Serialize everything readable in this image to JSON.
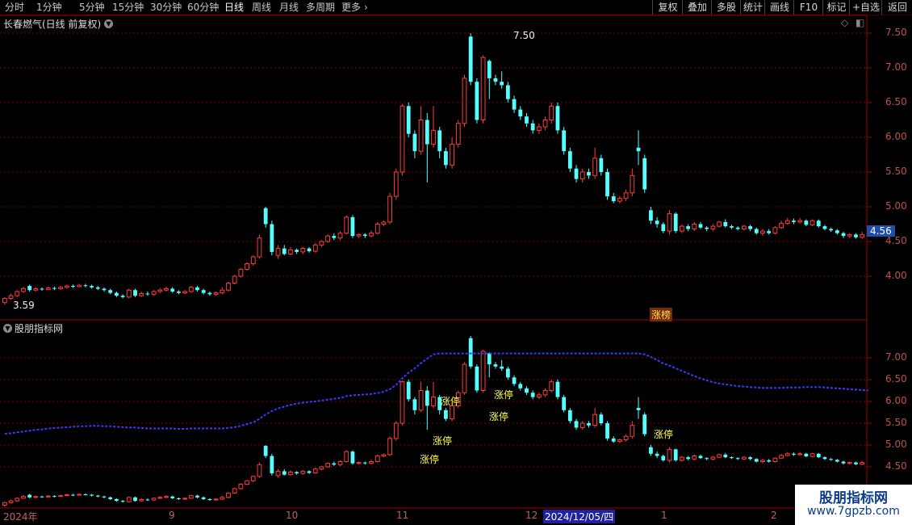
{
  "toolbar": {
    "periods": [
      "分时",
      "1分钟",
      "5分钟",
      "15分钟",
      "30分钟",
      "60分钟",
      "日线",
      "周线",
      "月线",
      "多周期",
      "更多"
    ],
    "active_period": "日线",
    "right_buttons": [
      "复权",
      "叠加",
      "多股",
      "统计",
      "画线",
      "F10",
      "标记",
      "+自选",
      "返回"
    ]
  },
  "main_panel": {
    "title": "长春燃气(日线 前复权)",
    "high_label": "7.50",
    "low_label": "3.59",
    "current_price": "4.56",
    "badge": "涨榜",
    "y_ticks": [
      "7.50",
      "7.00",
      "6.50",
      "6.00",
      "5.50",
      "5.00",
      "4.50",
      "4.00"
    ]
  },
  "indicator_panel": {
    "title": "股朋指标网",
    "y_ticks": [
      "7.00",
      "6.50",
      "6.00",
      "5.50",
      "5.00",
      "4.50"
    ],
    "signal_label": "涨停"
  },
  "x_axis": {
    "labels": [
      "2024年",
      "9",
      "10",
      "11",
      "12",
      "1",
      "2"
    ],
    "cursor_date": "2024/12/05/四"
  },
  "watermark": {
    "title": "股朋指标网",
    "url": "www.7gpzb.com"
  },
  "colors": {
    "up": "#ff3b3b",
    "down": "#54ffff",
    "grid": "#7a0000",
    "ma": "#3b3bff",
    "signal": "#ffff44"
  },
  "chart_data": {
    "type": "candlestick",
    "title": "长春燃气(日线 前复权)",
    "ylim": [
      3.55,
      7.7
    ],
    "candles": [
      [
        3.62,
        3.68,
        3.59,
        3.7
      ],
      [
        3.68,
        3.72,
        3.66,
        3.75
      ],
      [
        3.72,
        3.78,
        3.7,
        3.8
      ],
      [
        3.78,
        3.82,
        3.76,
        3.85
      ],
      [
        3.86,
        3.8,
        3.78,
        3.88
      ],
      [
        3.8,
        3.82,
        3.78,
        3.84
      ],
      [
        3.82,
        3.81,
        3.79,
        3.84
      ],
      [
        3.81,
        3.83,
        3.8,
        3.85
      ],
      [
        3.83,
        3.82,
        3.8,
        3.85
      ],
      [
        3.82,
        3.84,
        3.81,
        3.86
      ],
      [
        3.84,
        3.86,
        3.82,
        3.88
      ],
      [
        3.86,
        3.85,
        3.83,
        3.88
      ],
      [
        3.85,
        3.87,
        3.84,
        3.89
      ],
      [
        3.87,
        3.86,
        3.84,
        3.89
      ],
      [
        3.86,
        3.84,
        3.82,
        3.88
      ],
      [
        3.84,
        3.82,
        3.8,
        3.86
      ],
      [
        3.82,
        3.8,
        3.78,
        3.84
      ],
      [
        3.8,
        3.76,
        3.74,
        3.82
      ],
      [
        3.76,
        3.72,
        3.7,
        3.78
      ],
      [
        3.72,
        3.7,
        3.68,
        3.74
      ],
      [
        3.7,
        3.8,
        3.68,
        3.82
      ],
      [
        3.8,
        3.72,
        3.7,
        3.82
      ],
      [
        3.72,
        3.75,
        3.7,
        3.78
      ],
      [
        3.75,
        3.74,
        3.72,
        3.78
      ],
      [
        3.74,
        3.78,
        3.72,
        3.8
      ],
      [
        3.78,
        3.8,
        3.76,
        3.83
      ],
      [
        3.8,
        3.82,
        3.78,
        3.85
      ],
      [
        3.82,
        3.78,
        3.76,
        3.84
      ],
      [
        3.78,
        3.76,
        3.74,
        3.8
      ],
      [
        3.76,
        3.78,
        3.74,
        3.8
      ],
      [
        3.78,
        3.84,
        3.76,
        3.86
      ],
      [
        3.84,
        3.8,
        3.78,
        3.86
      ],
      [
        3.8,
        3.76,
        3.74,
        3.82
      ],
      [
        3.76,
        3.74,
        3.72,
        3.78
      ],
      [
        3.74,
        3.76,
        3.72,
        3.78
      ],
      [
        3.76,
        3.8,
        3.74,
        3.84
      ],
      [
        3.8,
        3.9,
        3.78,
        3.92
      ],
      [
        3.9,
        4.0,
        3.88,
        4.02
      ],
      [
        4.0,
        4.1,
        3.98,
        4.12
      ],
      [
        4.1,
        4.18,
        4.08,
        4.2
      ],
      [
        4.18,
        4.28,
        4.15,
        4.3
      ],
      [
        4.28,
        4.55,
        4.25,
        4.6
      ],
      [
        4.98,
        4.75,
        4.7,
        5.0
      ],
      [
        4.75,
        4.35,
        4.3,
        4.8
      ],
      [
        4.3,
        4.4,
        4.25,
        4.45
      ],
      [
        4.4,
        4.32,
        4.3,
        4.45
      ],
      [
        4.32,
        4.38,
        4.3,
        4.42
      ],
      [
        4.38,
        4.35,
        4.32,
        4.4
      ],
      [
        4.35,
        4.4,
        4.32,
        4.42
      ],
      [
        4.4,
        4.36,
        4.34,
        4.42
      ],
      [
        4.36,
        4.45,
        4.34,
        4.48
      ],
      [
        4.45,
        4.5,
        4.42,
        4.52
      ],
      [
        4.5,
        4.58,
        4.48,
        4.6
      ],
      [
        4.58,
        4.55,
        4.52,
        4.62
      ],
      [
        4.55,
        4.62,
        4.52,
        4.65
      ],
      [
        4.62,
        4.85,
        4.6,
        4.88
      ],
      [
        4.85,
        4.58,
        4.55,
        4.88
      ],
      [
        4.58,
        4.6,
        4.55,
        4.62
      ],
      [
        4.6,
        4.58,
        4.55,
        4.62
      ],
      [
        4.58,
        4.62,
        4.56,
        4.66
      ],
      [
        4.62,
        4.75,
        4.6,
        4.78
      ],
      [
        4.75,
        4.78,
        4.72,
        4.8
      ],
      [
        4.78,
        5.15,
        4.75,
        5.2
      ],
      [
        5.15,
        5.5,
        5.1,
        5.55
      ],
      [
        5.5,
        6.45,
        5.45,
        6.48
      ],
      [
        6.45,
        6.05,
        6.0,
        6.5
      ],
      [
        6.05,
        5.8,
        5.7,
        6.1
      ],
      [
        5.8,
        6.25,
        5.75,
        6.45
      ],
      [
        6.25,
        5.9,
        5.35,
        6.35
      ],
      [
        5.9,
        6.1,
        5.85,
        6.45
      ],
      [
        6.1,
        5.8,
        5.7,
        6.15
      ],
      [
        5.8,
        5.6,
        5.55,
        5.85
      ],
      [
        5.6,
        5.9,
        5.55,
        6.0
      ],
      [
        5.9,
        6.2,
        5.85,
        6.25
      ],
      [
        6.2,
        6.85,
        6.15,
        6.9
      ],
      [
        7.45,
        6.8,
        6.75,
        7.5
      ],
      [
        6.8,
        6.25,
        6.2,
        6.85
      ],
      [
        6.25,
        7.15,
        6.2,
        7.18
      ],
      [
        7.1,
        6.85,
        6.55,
        7.12
      ],
      [
        6.85,
        6.8,
        6.75,
        6.9
      ],
      [
        6.8,
        6.75,
        6.7,
        6.95
      ],
      [
        6.75,
        6.55,
        6.5,
        6.8
      ],
      [
        6.55,
        6.4,
        6.35,
        6.6
      ],
      [
        6.4,
        6.3,
        6.25,
        6.45
      ],
      [
        6.3,
        6.2,
        6.15,
        6.35
      ],
      [
        6.2,
        6.1,
        6.05,
        6.25
      ],
      [
        6.1,
        6.15,
        6.05,
        6.2
      ],
      [
        6.15,
        6.25,
        6.1,
        6.3
      ],
      [
        6.25,
        6.45,
        6.2,
        6.5
      ],
      [
        6.45,
        6.1,
        6.05,
        6.5
      ],
      [
        6.1,
        5.8,
        5.75,
        6.15
      ],
      [
        5.8,
        5.55,
        5.5,
        5.85
      ],
      [
        5.55,
        5.4,
        5.35,
        5.6
      ],
      [
        5.4,
        5.5,
        5.35,
        5.55
      ],
      [
        5.5,
        5.45,
        5.4,
        5.55
      ],
      [
        5.45,
        5.7,
        5.4,
        5.85
      ],
      [
        5.7,
        5.5,
        5.45,
        5.75
      ],
      [
        5.5,
        5.15,
        5.1,
        5.55
      ],
      [
        5.15,
        5.08,
        5.05,
        5.2
      ],
      [
        5.08,
        5.12,
        5.05,
        5.15
      ],
      [
        5.12,
        5.2,
        5.08,
        5.25
      ],
      [
        5.2,
        5.45,
        5.15,
        5.55
      ],
      [
        5.85,
        5.8,
        5.6,
        6.1
      ],
      [
        5.7,
        5.25,
        5.2,
        5.75
      ],
      [
        4.95,
        4.8,
        4.75,
        5.0
      ],
      [
        4.8,
        4.75,
        4.7,
        4.85
      ],
      [
        4.75,
        4.65,
        4.62,
        4.78
      ],
      [
        4.65,
        4.9,
        4.6,
        4.95
      ],
      [
        4.9,
        4.65,
        4.62,
        4.92
      ],
      [
        4.65,
        4.72,
        4.62,
        4.75
      ],
      [
        4.72,
        4.68,
        4.65,
        4.75
      ],
      [
        4.68,
        4.75,
        4.65,
        4.78
      ],
      [
        4.75,
        4.7,
        4.68,
        4.78
      ],
      [
        4.7,
        4.68,
        4.65,
        4.72
      ],
      [
        4.68,
        4.72,
        4.65,
        4.75
      ],
      [
        4.72,
        4.78,
        4.7,
        4.8
      ],
      [
        4.78,
        4.72,
        4.7,
        4.82
      ],
      [
        4.72,
        4.7,
        4.68,
        4.74
      ],
      [
        4.7,
        4.68,
        4.66,
        4.72
      ],
      [
        4.68,
        4.72,
        4.66,
        4.74
      ],
      [
        4.72,
        4.68,
        4.65,
        4.74
      ],
      [
        4.68,
        4.62,
        4.6,
        4.7
      ],
      [
        4.62,
        4.65,
        4.58,
        4.68
      ],
      [
        4.65,
        4.62,
        4.6,
        4.68
      ],
      [
        4.62,
        4.7,
        4.6,
        4.72
      ],
      [
        4.7,
        4.76,
        4.68,
        4.8
      ],
      [
        4.76,
        4.8,
        4.74,
        4.84
      ],
      [
        4.8,
        4.78,
        4.75,
        4.83
      ],
      [
        4.78,
        4.8,
        4.76,
        4.84
      ],
      [
        4.8,
        4.74,
        4.72,
        4.82
      ],
      [
        4.74,
        4.8,
        4.72,
        4.82
      ],
      [
        4.8,
        4.72,
        4.7,
        4.82
      ],
      [
        4.72,
        4.68,
        4.66,
        4.74
      ],
      [
        4.68,
        4.66,
        4.64,
        4.7
      ],
      [
        4.66,
        4.62,
        4.6,
        4.68
      ],
      [
        4.62,
        4.58,
        4.55,
        4.64
      ],
      [
        4.58,
        4.6,
        4.55,
        4.62
      ],
      [
        4.6,
        4.56,
        4.54,
        4.62
      ],
      [
        4.56,
        4.6,
        4.54,
        4.64
      ]
    ],
    "ma": [
      3.66,
      3.67,
      3.69,
      3.71,
      3.73,
      3.75,
      3.76,
      3.78,
      3.79,
      3.8,
      3.81,
      3.82,
      3.83,
      3.83,
      3.84,
      3.84,
      3.83,
      3.83,
      3.82,
      3.81,
      3.8,
      3.8,
      3.79,
      3.78,
      3.78,
      3.78,
      3.78,
      3.78,
      3.77,
      3.77,
      3.78,
      3.78,
      3.78,
      3.78,
      3.78,
      3.78,
      3.79,
      3.81,
      3.84,
      3.88,
      3.92,
      4.0,
      4.1,
      4.18,
      4.24,
      4.28,
      4.32,
      4.35,
      4.37,
      4.39,
      4.4,
      4.42,
      4.44,
      4.46,
      4.48,
      4.52,
      4.54,
      4.55,
      4.56,
      4.57,
      4.59,
      4.62,
      4.68,
      4.78,
      4.93,
      5.06,
      5.16,
      5.28,
      5.38,
      5.48,
      5.55,
      5.6,
      5.65,
      5.71,
      5.82,
      5.95,
      6.02,
      6.12,
      6.2,
      6.26,
      6.3,
      6.33,
      6.34,
      6.34,
      6.33,
      6.32,
      6.3,
      6.29,
      6.29,
      6.27,
      6.23,
      6.17,
      6.1,
      6.03,
      5.97,
      5.92,
      5.86,
      5.78,
      5.7,
      5.62,
      5.56,
      5.53,
      5.52,
      5.48,
      5.42,
      5.35,
      5.27,
      5.22,
      5.16,
      5.1,
      5.04,
      4.98,
      4.93,
      4.88,
      4.84,
      4.81,
      4.79,
      4.77,
      4.75,
      4.74,
      4.73,
      4.72,
      4.71,
      4.71,
      4.71,
      4.71,
      4.72,
      4.72,
      4.72,
      4.73,
      4.73,
      4.73,
      4.72,
      4.71,
      4.7,
      4.69,
      4.68,
      4.67,
      4.66,
      4.65
    ]
  }
}
